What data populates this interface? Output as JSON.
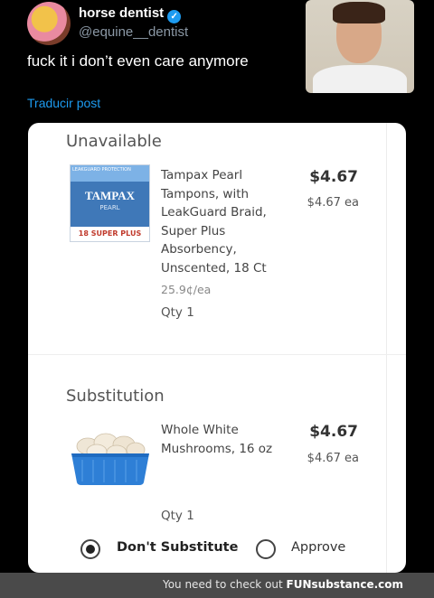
{
  "tweet": {
    "display_name": "horse dentist",
    "handle": "@equine__dentist",
    "text": "fuck it i don’t even care anymore",
    "translate_link": "Traducir post",
    "verified_glyph": "✓"
  },
  "unavailable": {
    "section_title": "Unavailable",
    "product_name": "Tampax Pearl Tampons, with LeakGuard Braid, Super Plus Absorbency, Unscented, 18 Ct",
    "price": "$4.67",
    "unit_price": "$4.67 ea",
    "unit_cost": "25.9¢/ea",
    "qty": "Qty 1",
    "package": {
      "brand": "TAMPAX",
      "line": "PEARL",
      "count": "18",
      "absorbency": "SUPER PLUS",
      "top_label": "LEAKGUARD PROTECTION"
    }
  },
  "substitution": {
    "section_title": "Substitution",
    "product_name": "Whole White Mushrooms, 16 oz",
    "price": "$4.67",
    "unit_price": "$4.67 ea",
    "qty": "Qty 1"
  },
  "options": {
    "dont_substitute_label": "Don't Substitute",
    "approve_label": "Approve",
    "selected": "dont_substitute"
  },
  "footer": {
    "text": "You need to check out",
    "brand": "FUNsubstance.com"
  },
  "colors": {
    "background": "#000000",
    "link": "#1d9bf0",
    "verified": "#1d9bf0",
    "mushroom_basket": "#2e7fd6"
  }
}
